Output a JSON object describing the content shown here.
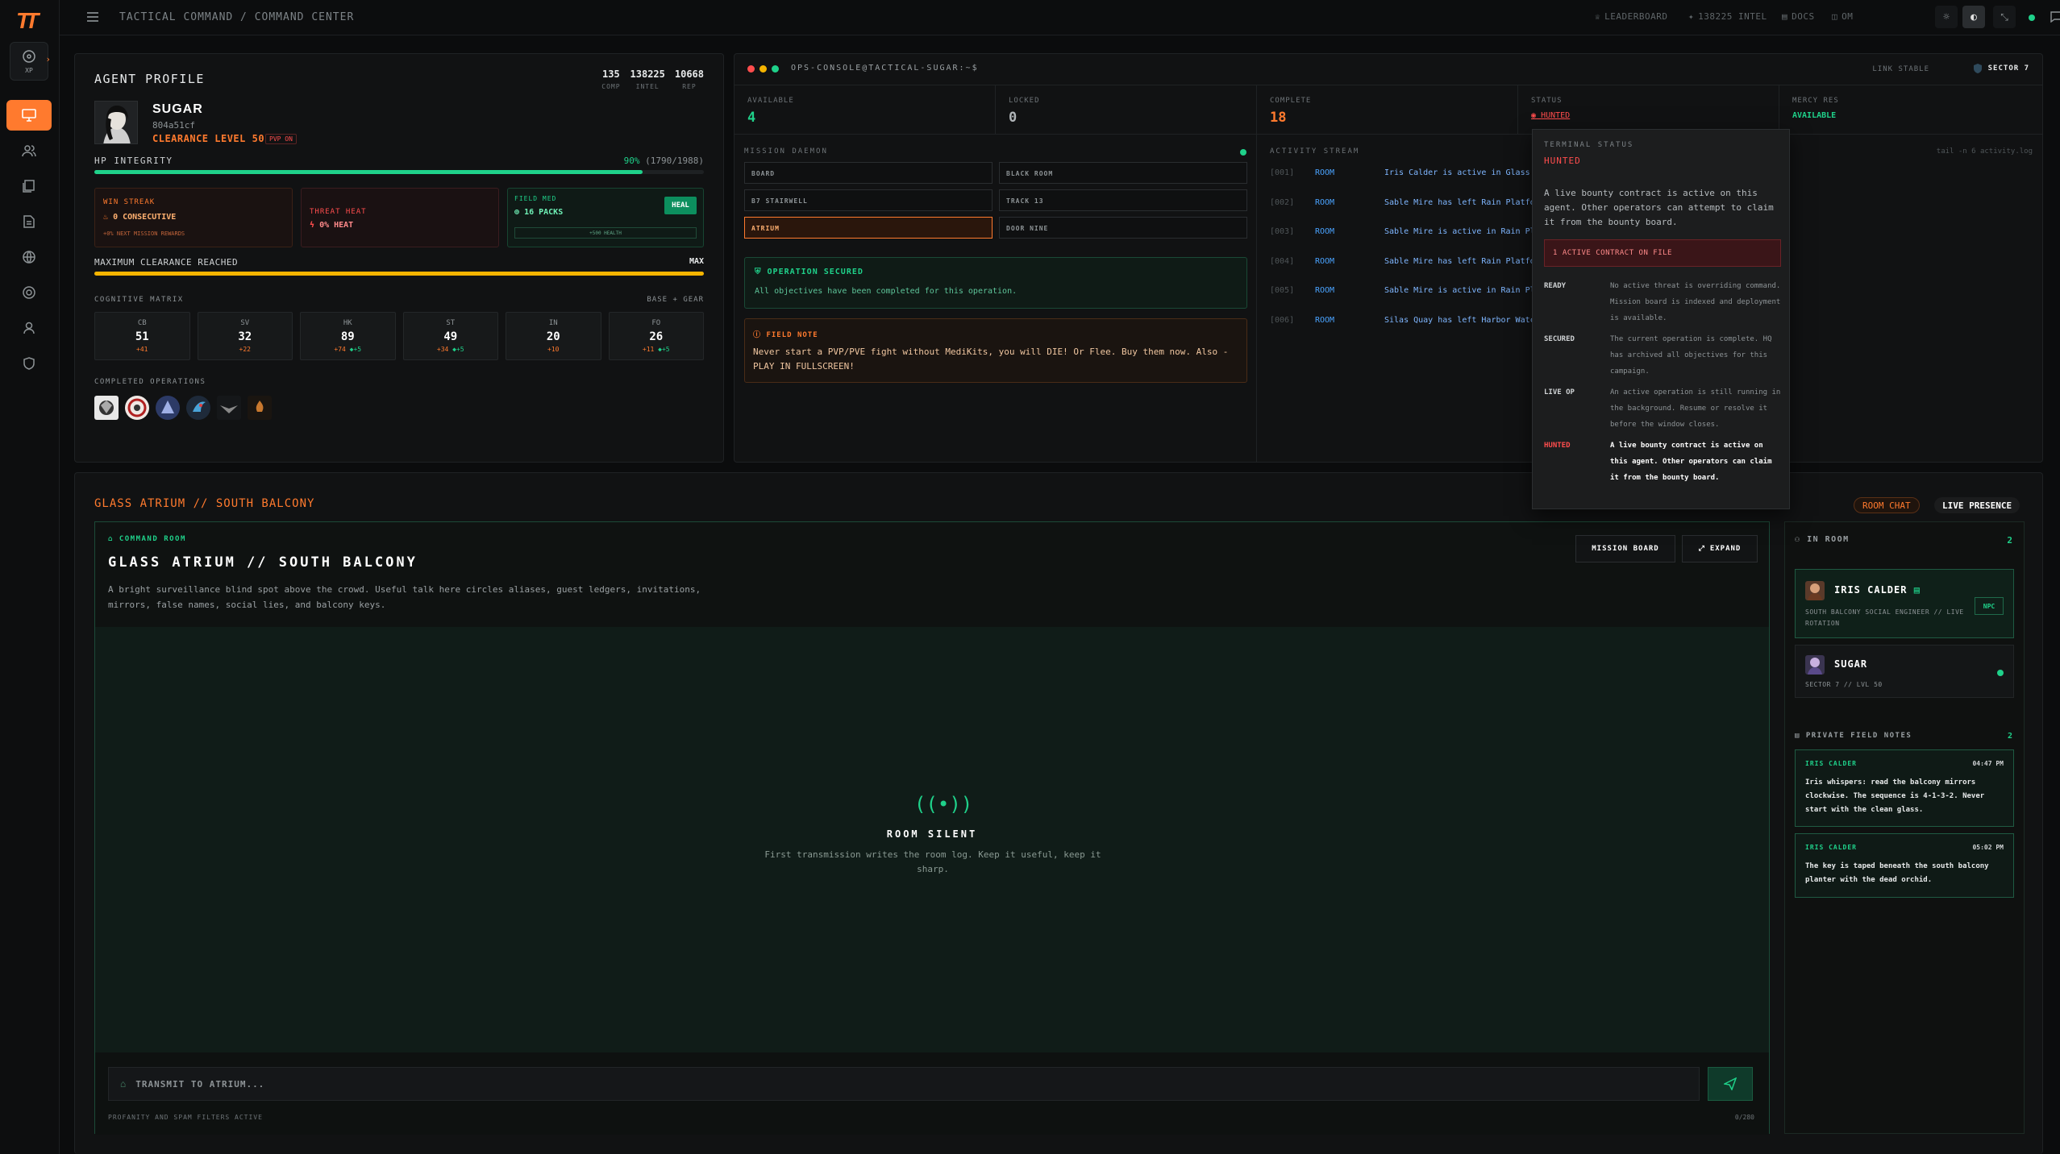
{
  "app": {
    "logo": "TT",
    "xp_label": "XP"
  },
  "topbar": {
    "breadcrumb": "TACTICAL COMMAND / COMMAND CENTER",
    "leaderboard": "LEADERBOARD",
    "intel": "138225 INTEL",
    "docs": "DOCS",
    "om": "OM"
  },
  "profile": {
    "title": "AGENT PROFILE",
    "stats": [
      {
        "value": "135",
        "label": "COMP"
      },
      {
        "value": "138225",
        "label": "INTEL"
      },
      {
        "value": "10668",
        "label": "REP"
      }
    ],
    "name": "SUGAR",
    "id": "804a51cf",
    "clearance": "CLEARANCE LEVEL 50",
    "pvp": "PVP ON",
    "hp_label": "HP INTEGRITY",
    "hp_pct": "90%",
    "hp_detail": "(1790/1988)",
    "hp_fraction": 0.9,
    "win_streak": {
      "label": "WIN STREAK",
      "value": "0 CONSECUTIVE",
      "sub": "+0% NEXT MISSION REWARDS"
    },
    "threat_heat": {
      "label": "THREAT HEAT",
      "value": "0% HEAT"
    },
    "field_med": {
      "label": "FIELD MED",
      "value": "16 PACKS",
      "heal": "HEAL",
      "sub": "+500 HEALTH"
    },
    "clearance_max_label": "MAXIMUM CLEARANCE REACHED",
    "clearance_max": "MAX",
    "clearance_fraction": 1.0,
    "matrix_title": "COGNITIVE MATRIX",
    "matrix_right": "BASE + GEAR",
    "matrix": [
      {
        "k": "CB",
        "v": "51",
        "b": "+41",
        "b2": ""
      },
      {
        "k": "SV",
        "v": "32",
        "b": "+22",
        "b2": ""
      },
      {
        "k": "HK",
        "v": "89",
        "b": "+74",
        "b2": "+5"
      },
      {
        "k": "ST",
        "v": "49",
        "b": "+34",
        "b2": "+5"
      },
      {
        "k": "IN",
        "v": "20",
        "b": "+10",
        "b2": ""
      },
      {
        "k": "FO",
        "v": "26",
        "b": "+11",
        "b2": "+5"
      }
    ],
    "completed_title": "COMPLETED OPERATIONS"
  },
  "console": {
    "title": "OPS-CONSOLE@TACTICAL-SUGAR:~$",
    "link": "LINK STABLE",
    "sector": "SECTOR 7",
    "available": {
      "label": "AVAILABLE",
      "value": "4"
    },
    "locked": {
      "label": "LOCKED",
      "value": "0"
    },
    "complete": {
      "label": "COMPLETE",
      "value": "18"
    },
    "status": {
      "label": "STATUS",
      "value": "HUNTED"
    },
    "mercy": {
      "label": "MERCY RES",
      "value": "AVAILABLE"
    },
    "daemon_title": "MISSION DAEMON",
    "rooms": [
      "BOARD",
      "BLACK ROOM",
      "B7 STAIRWELL",
      "TRACK 13",
      "ATRIUM",
      "DOOR NINE"
    ],
    "secured_title": "OPERATION SECURED",
    "secured_text": "All objectives have been completed for this operation.",
    "note_title": "FIELD NOTE",
    "note_text": "Never start a PVP/PVE fight without MediKits, you will DIE! Or Flee. Buy them now. Also - PLAY IN FULLSCREEN!",
    "stream_title": "ACTIVITY STREAM",
    "stream_cmd": "tail -n 6 activity.log",
    "stream": [
      {
        "n": "[001]",
        "t": "ROOM",
        "m": "Iris Calder is active in Glass Atrium"
      },
      {
        "n": "[002]",
        "t": "ROOM",
        "m": "Sable Mire has left Rain Platform"
      },
      {
        "n": "[003]",
        "t": "ROOM",
        "m": "Sable Mire is active in Rain Platform"
      },
      {
        "n": "[004]",
        "t": "ROOM",
        "m": "Sable Mire has left Rain Platform"
      },
      {
        "n": "[005]",
        "t": "ROOM",
        "m": "Sable Mire is active in Rain Platform"
      },
      {
        "n": "[006]",
        "t": "ROOM",
        "m": "Silas Quay has left Harbor Watch"
      }
    ]
  },
  "tooltip": {
    "title": "TERMINAL STATUS",
    "status": "HUNTED",
    "desc": "A live bounty contract is active on this agent. Other operators can attempt to claim it from the bounty board.",
    "contract": "1 ACTIVE CONTRACT ON FILE",
    "rows": [
      {
        "k": "READY",
        "v": "No active threat is overriding command. Mission board is indexed and deployment is available."
      },
      {
        "k": "SECURED",
        "v": "The current operation is complete. HQ has archived all objectives for this campaign."
      },
      {
        "k": "LIVE OP",
        "v": "An active operation is still running in the background. Resume or resolve it before the window closes."
      },
      {
        "k": "HUNTED",
        "v": "A live bounty contract is active on this agent. Other operators can claim it from the bounty board."
      }
    ]
  },
  "room": {
    "header": "GLASS ATRIUM // SOUTH BALCONY",
    "tab_chat": "ROOM CHAT",
    "tab_presence": "LIVE PRESENCE",
    "kicker": "COMMAND ROOM",
    "title": "GLASS ATRIUM // SOUTH BALCONY",
    "desc": "A bright surveillance blind spot above the crowd. Useful talk here circles aliases, guest ledgers, invitations, mirrors, false names, social lies, and balcony keys.",
    "mission_board": "MISSION BOARD",
    "expand": "EXPAND",
    "silent_title": "ROOM SILENT",
    "silent_text": "First transmission writes the room log. Keep it useful, keep it sharp.",
    "input_placeholder": "TRANSMIT TO ATRIUM...",
    "filter_text": "PROFANITY AND SPAM FILTERS ACTIVE",
    "counter": "0/280"
  },
  "presence": {
    "in_room": "IN ROOM",
    "count": "2",
    "people": [
      {
        "name": "IRIS CALDER",
        "sub": "SOUTH BALCONY SOCIAL ENGINEER // LIVE ROTATION",
        "tag": "NPC"
      },
      {
        "name": "SUGAR",
        "sub": "SECTOR 7 // LVL 50",
        "tag": ""
      }
    ],
    "notes_title": "PRIVATE FIELD NOTES",
    "notes_count": "2",
    "notes": [
      {
        "who": "IRIS CALDER",
        "time": "04:47 PM",
        "text": "Iris whispers: read the balcony mirrors clockwise. The sequence is 4-1-3-2. Never start with the clean glass."
      },
      {
        "who": "IRIS CALDER",
        "time": "05:02 PM",
        "text": "The key is taped beneath the south balcony planter with the dead orchid."
      }
    ]
  },
  "colors": {
    "accent": "#ff7a2e",
    "green": "#1fd18a",
    "red": "#ff4d4d",
    "yellow": "#f5b400"
  }
}
